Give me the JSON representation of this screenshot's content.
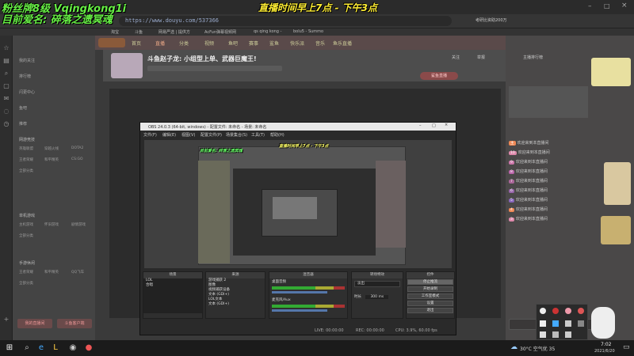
{
  "overlay": {
    "top_left_1": "粉丝牌8级 Vqingkong1i",
    "top_left_2": "目前爱名: 碎落之遗冥魂",
    "top_center": "直播时间早上7点 - 下午3点",
    "obs_inner_1": "直播时间早上7点 - 下午3点",
    "obs_inner_2": "目前爱名: 碎落之遗冥魂"
  },
  "browser": {
    "tab_title": "斗鱼",
    "url": "https://www.douyu.com/537366",
    "search_hint": "考研比资助200万",
    "bookmarks": [
      "淘宝",
      "斗鱼",
      "网易严选 | 提供方",
      "AcFun弹幕视频网",
      "qs qing kong -",
      "bolu5 - Summo"
    ]
  },
  "sidebar": {
    "sections": [
      "我的关注",
      "排行榜",
      "闪更中心",
      "鱼吧",
      "推荐"
    ],
    "group1_title": "网游竞技",
    "group1_items": [
      "英雄联盟",
      "穿越火线",
      "DOTA2",
      "王者荣耀",
      "和平精英",
      "CS:GO",
      "全部分类"
    ],
    "group2_title": "单机游戏",
    "group2_items": [
      "主机游戏",
      "怀旧游戏",
      "剧情游戏",
      "全部分类"
    ],
    "group3_title": "手游休闲",
    "group3_items": [
      "王者荣耀",
      "和平精英",
      "QQ飞车",
      "全部分类"
    ],
    "btn_left": "我的直播间",
    "btn_right": "斗鱼客户端"
  },
  "douyu_nav": [
    "首页",
    "直播",
    "分类",
    "视频",
    "鱼吧",
    "赛事",
    "鲨鱼",
    "快乐派",
    "音乐",
    "鱼乐直播"
  ],
  "room": {
    "title": "斗鱼赵子龙: 小组型上单、武器巨魔王!",
    "follow": "关注",
    "report": "举报",
    "gift_btn": "鲨鱼直播"
  },
  "obs": {
    "title": "OBS 24.0.3 (64-bit, windows) - 配置文件: 未命名 - 场景: 未命名",
    "menu": [
      "文件(F)",
      "编辑(E)",
      "视图(V)",
      "配置文件(P)",
      "场景集合(S)",
      "工具(T)",
      "帮助(H)"
    ],
    "dock_scenes_title": "场景",
    "scenes": [
      "LOL",
      "合唱"
    ],
    "dock_sources_title": "来源",
    "sources": [
      "游戏捕获 2",
      "图像",
      "视频捕获设备",
      "文本 (GDI+)",
      "LOL文本",
      "文本 (GDI+)"
    ],
    "dock_mixer_title": "混音器",
    "mixer": [
      "桌面音频",
      "麦克风/Aux"
    ],
    "mixer_db": "0.0 dB",
    "dock_transitions_title": "转场特效",
    "transition": "淡出",
    "duration_label": "时长",
    "duration": "300 ms",
    "dock_controls_title": "控件",
    "controls": [
      "停止推流",
      "开始录制",
      "工作室模式",
      "设置",
      "退出"
    ],
    "status": {
      "live": "LIVE: 00:00:00",
      "rec": "REC: 00:00:00",
      "cpu": "CPU: 3.9%, 60.00 fps"
    }
  },
  "chat": {
    "title": "主播排行榜",
    "rows": [
      {
        "badge": "主",
        "color": "#e85",
        "text": "欢迎来到本直播间"
      },
      {
        "badge": "10",
        "color": "#d8a",
        "text": "欢迎来到本直播间"
      },
      {
        "badge": "9",
        "color": "#c7a",
        "text": "欢迎来到本直播间"
      },
      {
        "badge": "8",
        "color": "#b6a",
        "text": "欢迎来到本直播间"
      },
      {
        "badge": "7",
        "color": "#a69",
        "text": "欢迎来到本直播间"
      },
      {
        "badge": "6",
        "color": "#96a",
        "text": "欢迎来到本直播间"
      },
      {
        "badge": "5",
        "color": "#86b",
        "text": "欢迎来到本直播间"
      },
      {
        "badge": "4",
        "color": "#e85",
        "text": "欢迎来到本直播间"
      },
      {
        "badge": "3",
        "color": "#d8a",
        "text": "欢迎来到本直播间"
      }
    ]
  },
  "taskbar": {
    "weather": "30°C 空气优 35",
    "time": "7:02",
    "date": "2021/6/20"
  }
}
